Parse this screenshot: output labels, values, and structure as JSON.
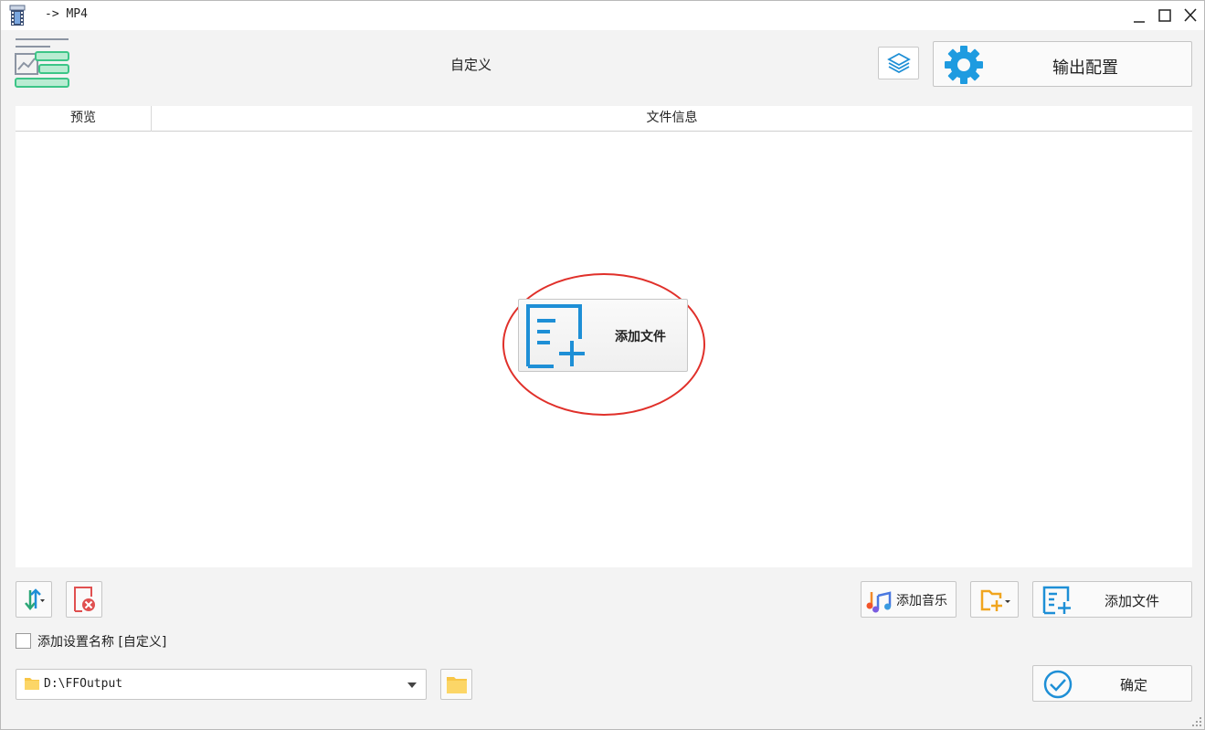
{
  "window": {
    "title": "-> MP4",
    "controls": [
      "minimize",
      "maximize",
      "close"
    ]
  },
  "header": {
    "preset_name": "自定义",
    "layers_icon": "layers-icon",
    "output_config_label": "输出配置"
  },
  "file_list": {
    "columns": [
      "预览",
      "文件信息"
    ],
    "center_add_label": "添加文件",
    "rows": []
  },
  "toolbar": {
    "sort_icon": "sort-arrows-icon",
    "remove_icon": "remove-file-icon",
    "add_music_label": "添加音乐",
    "add_folder_icon": "add-folder-icon",
    "add_file_label": "添加文件"
  },
  "options": {
    "add_preset_name_label": "添加设置名称 [自定义]",
    "add_preset_name_checked": false
  },
  "output": {
    "path": "D:\\FFOutput",
    "ok_label": "确定"
  },
  "colors": {
    "accent_blue": "#1e8fd6",
    "annotation_red": "#e0302a",
    "logo_green": "#3cc587",
    "folder_yellow": "#f8c646"
  }
}
